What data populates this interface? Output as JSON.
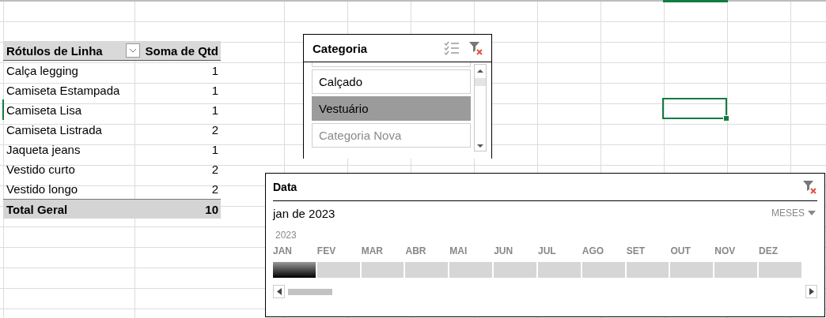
{
  "pivot_table": {
    "header": {
      "row_label": "Rótulos de Linha",
      "value_label": "Soma de Qtd"
    },
    "rows": [
      {
        "label": "Calça legging",
        "value": "1"
      },
      {
        "label": "Camiseta Estampada",
        "value": "1"
      },
      {
        "label": "Camiseta Lisa",
        "value": "1"
      },
      {
        "label": "Camiseta Listrada",
        "value": "2"
      },
      {
        "label": "Jaqueta jeans",
        "value": "1"
      },
      {
        "label": "Vestido curto",
        "value": "2"
      },
      {
        "label": "Vestido longo",
        "value": "2"
      }
    ],
    "total": {
      "label": "Total Geral",
      "value": "10"
    }
  },
  "category_slicer": {
    "title": "Categoria",
    "items": [
      {
        "label": "Calçado",
        "selected": false,
        "disabled": false
      },
      {
        "label": "Vestuário",
        "selected": true,
        "disabled": false
      },
      {
        "label": "Categoria Nova",
        "selected": false,
        "disabled": true
      }
    ]
  },
  "date_timeline": {
    "title": "Data",
    "range_label": "jan de 2023",
    "level": "MESES",
    "year": "2023",
    "months": [
      {
        "label": "JAN",
        "selected": true
      },
      {
        "label": "FEV",
        "selected": false
      },
      {
        "label": "MAR",
        "selected": false
      },
      {
        "label": "ABR",
        "selected": false
      },
      {
        "label": "MAI",
        "selected": false
      },
      {
        "label": "JUN",
        "selected": false
      },
      {
        "label": "JUL",
        "selected": false
      },
      {
        "label": "AGO",
        "selected": false
      },
      {
        "label": "SET",
        "selected": false
      },
      {
        "label": "OUT",
        "selected": false
      },
      {
        "label": "NOV",
        "selected": false
      },
      {
        "label": "DEZ",
        "selected": false
      }
    ]
  }
}
